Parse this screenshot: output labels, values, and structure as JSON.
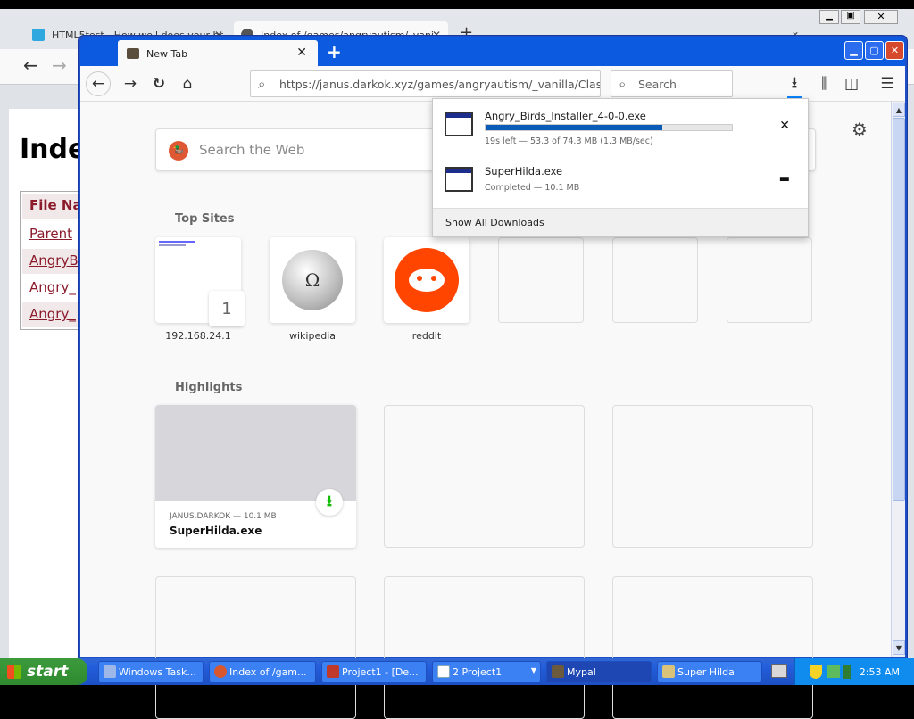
{
  "background_window": {
    "tabs": [
      {
        "title": "HTML5test - How well does your br",
        "icon_color": "#2fa8e0"
      },
      {
        "title": "Index of /games/angryautism/_vani",
        "icon_color": "#555555"
      }
    ],
    "page_heading": "Inde",
    "table_rows": [
      "File Na",
      "Parent",
      "AngryB",
      "Angry_",
      "Angry_"
    ]
  },
  "window": {
    "active_tab_title": "New Tab",
    "new_tab_symbol": "+",
    "url": "https://janus.darkok.xyz/games/angryautism/_vanilla/Classic/l",
    "search_placeholder": "Search"
  },
  "newtab_page": {
    "web_search_placeholder": "Search the Web",
    "top_sites_heading": "Top Sites",
    "top_sites": [
      {
        "label": "192.168.24.1",
        "badge": "1"
      },
      {
        "label": "wikipedia"
      },
      {
        "label": "reddit"
      }
    ],
    "highlights_heading": "Highlights",
    "highlight_card": {
      "source": "JANUS.DARKOK — 10.1 MB",
      "title": "SuperHilda.exe"
    }
  },
  "downloads_panel": {
    "items": [
      {
        "name": "Angry_Birds_Installer_4-0-0.exe",
        "status": "19s left — 53.3 of 74.3 MB (1.3 MB/sec)",
        "progress": 0.717,
        "action_icon": "close-icon"
      },
      {
        "name": "SuperHilda.exe",
        "status": "Completed — 10.1 MB",
        "action_icon": "folder-icon"
      }
    ],
    "footer_label": "Show All Downloads"
  },
  "taskbar": {
    "start_label": "start",
    "tasks": [
      {
        "label": "Windows Task...",
        "icon_color": "#9db8e8"
      },
      {
        "label": "Index of /gam...",
        "icon_color": "#d9572f"
      },
      {
        "label": "Project1 - [De...",
        "icon_color": "#c0392b"
      },
      {
        "label": "2 Project1",
        "icon_color": "#ffffff"
      },
      {
        "label": "Mypal",
        "icon_color": "#6b5a3e"
      },
      {
        "label": "Super Hilda",
        "icon_color": "#d9c27a"
      }
    ],
    "clock": "2:53 AM"
  },
  "colors": {
    "window_frame": "#0b5ae0",
    "taskbar": "#245edb",
    "start_button": "#3c9a3c",
    "download_progress": "#0a5cb8",
    "reddit": "#ff4500",
    "duckduckgo": "#de5833",
    "link": "#8b1a2b"
  }
}
